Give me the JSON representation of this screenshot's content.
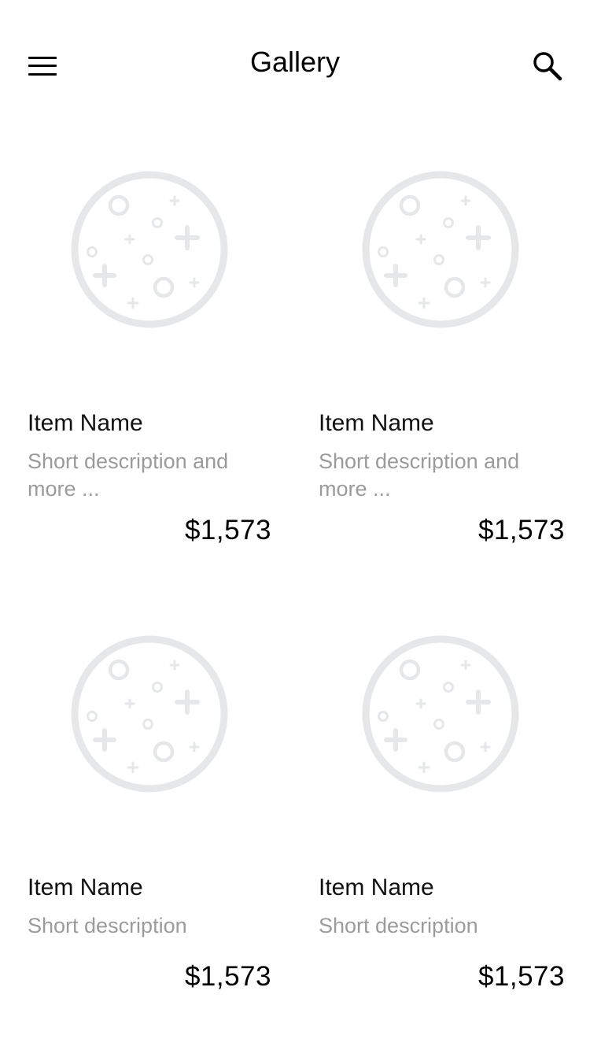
{
  "header": {
    "title": "Gallery",
    "menu_icon": "hamburger-menu-icon",
    "search_icon": "search-icon"
  },
  "items": [
    {
      "name": "Item Name",
      "description": "Short description and more ...",
      "price": "$1,573",
      "image_icon": "placeholder-image-icon"
    },
    {
      "name": "Item Name",
      "description": "Short description and more ...",
      "price": "$1,573",
      "image_icon": "placeholder-image-icon"
    },
    {
      "name": "Item Name",
      "description": "Short description",
      "price": "$1,573",
      "image_icon": "placeholder-image-icon"
    },
    {
      "name": "Item Name",
      "description": "Short description",
      "price": "$1,573",
      "image_icon": "placeholder-image-icon"
    }
  ],
  "colors": {
    "placeholder": "#e6e7e9",
    "description_text": "#9b9b9b",
    "primary_text": "#000000"
  }
}
